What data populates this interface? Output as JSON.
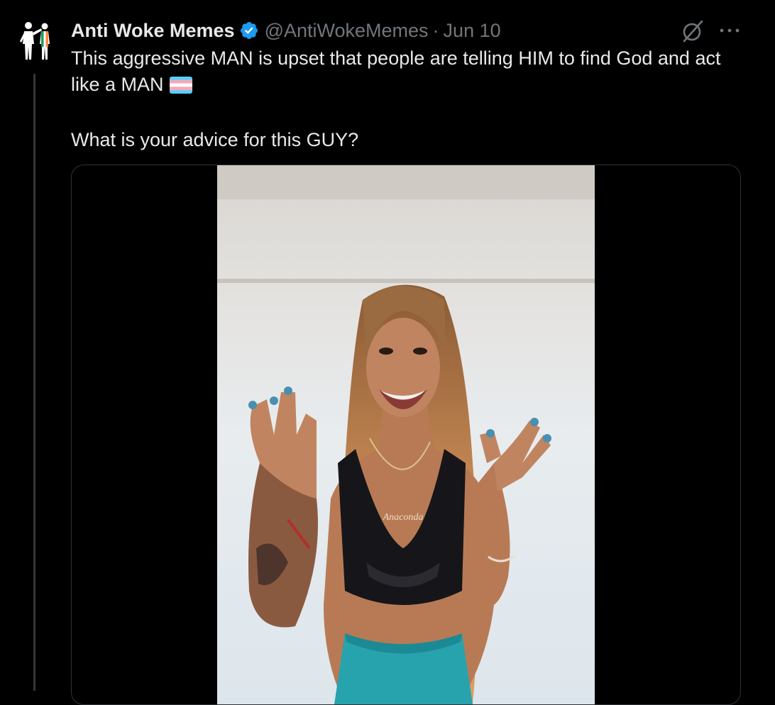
{
  "tweet": {
    "display_name": "Anti Woke Memes",
    "handle": "@AntiWokeMemes",
    "separator": "·",
    "date": "Jun 10",
    "text_line1": "This aggressive MAN is upset that people are telling HIM to find God and act like a MAN",
    "text_line2": "What is your advice for this GUY?",
    "flag_emoji": "transgender-flag",
    "verified": true
  },
  "media": {
    "type": "video",
    "necklace_text": "Anaconda"
  },
  "icons": {
    "avatar": "avatar-silhouette-icon",
    "verified": "verified-badge-icon",
    "grok": "grok-icon",
    "more": "more-options-icon"
  },
  "colors": {
    "background": "#000000",
    "text_primary": "#e7e9ea",
    "text_secondary": "#71767b",
    "verified_blue": "#1d9bf0",
    "border": "#2f3336"
  }
}
